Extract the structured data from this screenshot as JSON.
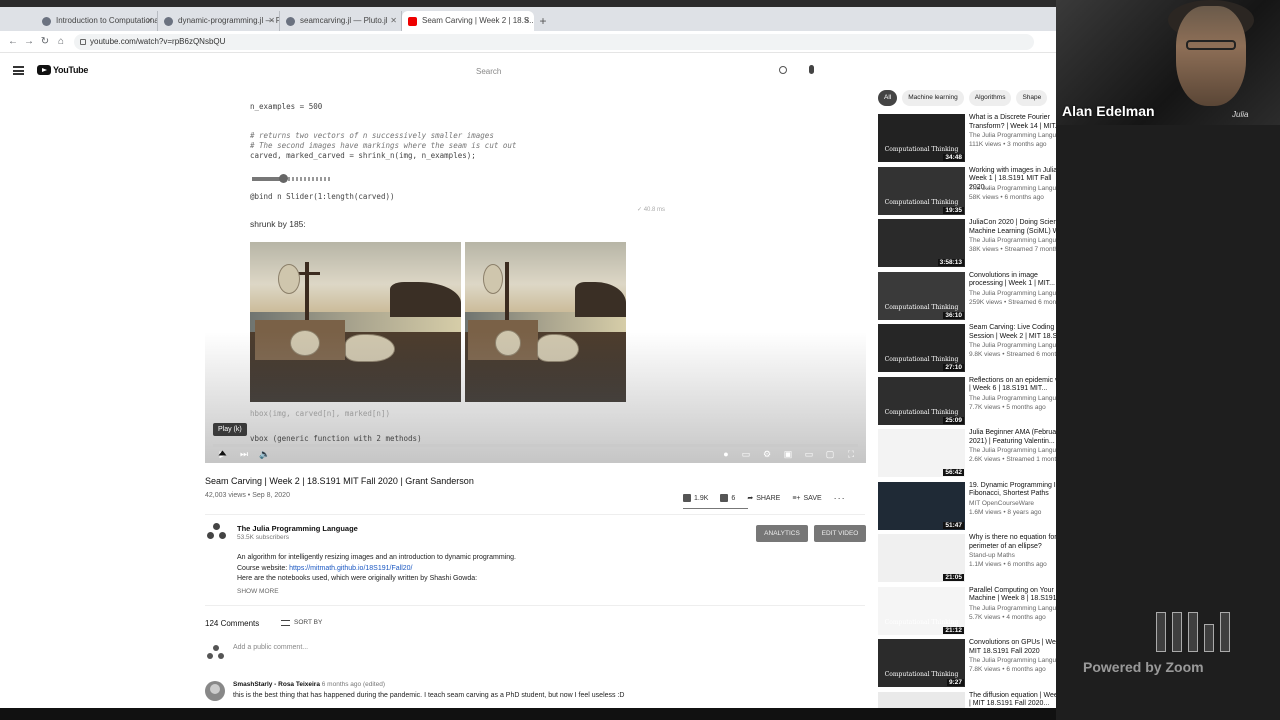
{
  "browser": {
    "tabs": [
      {
        "label": "Introduction to Computational...",
        "active": false
      },
      {
        "label": "dynamic-programming.jl — Plu...",
        "active": false
      },
      {
        "label": "seamcarving.jl — Pluto.jl",
        "active": false
      },
      {
        "label": "Seam Carving | Week 2 | 18.S...",
        "active": true
      }
    ],
    "url": "youtube.com/watch?v=rpB6zQNsbQU"
  },
  "youtube": {
    "logo_text": "YouTube",
    "search_placeholder": "Search"
  },
  "notebook": {
    "line1": "n_examples = 500",
    "comment1": "# returns two vectors of n successively smaller images",
    "comment2": "# The second images have markings where the seam is cut out",
    "line2": "carved, marked_carved = shrink_n(img, n_examples);",
    "bind_line": "@bind n Slider(1:length(carved))",
    "shrunk_label": "shrunk by 185:",
    "timing": "✓ 40.8 ms",
    "vcat_line": "hbox(img, carved[n], marked[n])",
    "hbox_line": "vbox (generic function with 2 methods)",
    "slider_value": 0.4
  },
  "player": {
    "tooltip": "Play (k)"
  },
  "video": {
    "title": "Seam Carving | Week 2 | 18.S191 MIT Fall 2020 | Grant Sanderson",
    "views": "42,003 views",
    "date": "Sep 8, 2020",
    "likes": "1.9K",
    "dislikes": "6",
    "share": "SHARE",
    "save": "SAVE",
    "more": "···"
  },
  "channel": {
    "name": "The Julia Programming Language",
    "subs": "53.5K subscribers",
    "analytics": "ANALYTICS",
    "edit": "EDIT VIDEO"
  },
  "description": {
    "line1": "An algorithm for intelligently resizing images and an introduction to dynamic programming.",
    "line2_prefix": "Course website: ",
    "line2_link": "https://mitmath.github.io/18S191/Fall20/",
    "line3": "Here are the notebooks used, which were originally written by Shashi Gowda:",
    "show_more": "SHOW MORE"
  },
  "comments": {
    "count": "124 Comments",
    "sort": "SORT BY",
    "add_placeholder": "Add a public comment...",
    "first": {
      "author": "SmashStarly - Rosa Teixeira",
      "time": "6 months ago (edited)",
      "text": "this is the best thing that has happened during the pandemic. I teach seam carving as a PhD student, but now I feel useless :D"
    }
  },
  "chips": [
    "All",
    "Machine learning",
    "Algorithms",
    "Shape"
  ],
  "recommendations": [
    {
      "title": "What is a Discrete Fourier Transform? | Week 14 | MIT...",
      "channel": "The Julia Programming Language",
      "meta": "111K views • 3 months ago",
      "duration": "34:48",
      "thumb_text": "Computational Thinking"
    },
    {
      "title": "Working with images in Julia | Week 1 | 18.S191 MIT Fall 2020...",
      "channel": "The Julia Programming Language",
      "meta": "58K views • 6 months ago",
      "duration": "19:35",
      "thumb_text": "Computational Thinking"
    },
    {
      "title": "JuliaCon 2020 | Doing Scientific Machine Learning (SciML) With...",
      "channel": "The Julia Programming Language",
      "meta": "38K views • Streamed 7 months ago",
      "duration": "3:58:13",
      "thumb_text": ""
    },
    {
      "title": "Convolutions in image processing | Week 1 | MIT...",
      "channel": "The Julia Programming Language",
      "meta": "259K views • Streamed 6 months ago",
      "duration": "36:10",
      "thumb_text": "Computational Thinking"
    },
    {
      "title": "Seam Carving: Live Coding Session | Week 2 | MIT 18.S19...",
      "channel": "The Julia Programming Language",
      "meta": "9.8K views • Streamed 6 months ago",
      "duration": "27:10",
      "thumb_text": "Computational Thinking"
    },
    {
      "title": "Reflections on an epidemic video | Week 6 | 18.S191 MIT...",
      "channel": "The Julia Programming Language",
      "meta": "7.7K views • 5 months ago",
      "duration": "25:09",
      "thumb_text": "Computational Thinking"
    },
    {
      "title": "Julia Beginner AMA (February 2021) | Featuring Valentin...",
      "channel": "The Julia Programming Language",
      "meta": "2.6K views • Streamed 1 month ago",
      "duration": "56:42",
      "thumb_text": ""
    },
    {
      "title": "19. Dynamic Programming I: Fibonacci, Shortest Paths",
      "channel": "MIT OpenCourseWare",
      "meta": "1.6M views • 8 years ago",
      "duration": "51:47",
      "thumb_text": ""
    },
    {
      "title": "Why is there no equation for the perimeter of an ellipse?",
      "channel": "Stand-up Maths",
      "meta": "1.1M views • 6 months ago",
      "duration": "21:05",
      "thumb_text": ""
    },
    {
      "title": "Parallel Computing on Your Own Machine | Week 8 | 18.S191...",
      "channel": "The Julia Programming Language",
      "meta": "5.7K views • 4 months ago",
      "duration": "21:12",
      "thumb_text": "Computational Thinking"
    },
    {
      "title": "Convolutions on GPUs | Week 2 | MIT 18.S191 Fall 2020",
      "channel": "The Julia Programming Language",
      "meta": "7.8K views • 6 months ago",
      "duration": "9:27",
      "thumb_text": "Computational Thinking"
    },
    {
      "title": "The diffusion equation | Week 12 | MIT 18.S191 Fall 2020...",
      "channel": "The Julia Programming Language",
      "meta": "",
      "duration": "",
      "thumb_text": ""
    }
  ],
  "webcam": {
    "name": "Alan Edelman",
    "corner": "Julia",
    "powered": "Powered by Zoom"
  }
}
